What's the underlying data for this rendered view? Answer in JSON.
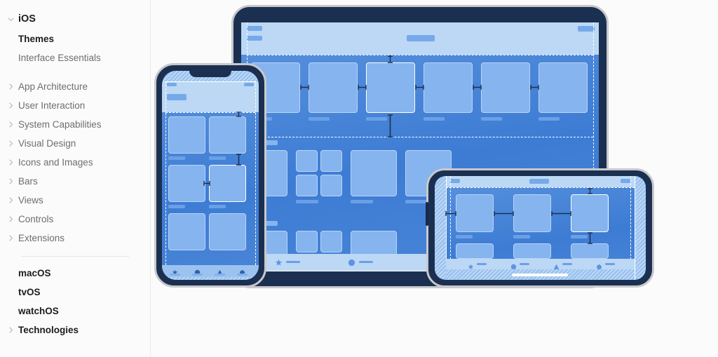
{
  "sidebar": {
    "root": {
      "label": "iOS",
      "icon": "chevron-down-icon",
      "expanded": true
    },
    "sub_items": [
      {
        "label": "Themes",
        "current": true
      },
      {
        "label": "Interface Essentials",
        "current": false
      }
    ],
    "groups": [
      {
        "label": "App Architecture",
        "icon": "chevron-right-icon"
      },
      {
        "label": "User Interaction",
        "icon": "chevron-right-icon"
      },
      {
        "label": "System Capabilities",
        "icon": "chevron-right-icon"
      },
      {
        "label": "Visual Design",
        "icon": "chevron-right-icon"
      },
      {
        "label": "Icons and Images",
        "icon": "chevron-right-icon"
      },
      {
        "label": "Bars",
        "icon": "chevron-right-icon"
      },
      {
        "label": "Views",
        "icon": "chevron-right-icon"
      },
      {
        "label": "Controls",
        "icon": "chevron-right-icon"
      },
      {
        "label": "Extensions",
        "icon": "chevron-right-icon"
      }
    ],
    "platforms": [
      {
        "label": "macOS",
        "icon": null
      },
      {
        "label": "tvOS",
        "icon": null
      },
      {
        "label": "watchOS",
        "icon": null
      },
      {
        "label": "Technologies",
        "icon": "chevron-right-icon"
      }
    ]
  },
  "illustration": {
    "description": "Adaptive layout diagram showing the same app content arranged on three device sizes with layout margin guides and spacing measurement marks.",
    "devices": [
      {
        "name": "tablet",
        "orientation": "landscape",
        "tab_icons": [
          "star-icon",
          "circle-icon"
        ]
      },
      {
        "name": "phone",
        "orientation": "portrait",
        "tab_icons": [
          "star-icon",
          "circle-icon",
          "triangle-icon",
          "pentagon-icon"
        ]
      },
      {
        "name": "phone-landscape",
        "orientation": "landscape",
        "tab_icons": [
          "star-icon",
          "circle-icon",
          "triangle-icon",
          "pentagon-icon"
        ]
      }
    ]
  },
  "colors": {
    "background": "#fbfbfb",
    "sidebar_text": "#6e6e73",
    "sidebar_text_active": "#1d1d1f",
    "device_bezel": "#1b3051",
    "device_edge": "#c9c9cd",
    "screen_blue": "#4a86d8",
    "card_blue": "#85b4ef",
    "header_blue": "#bcd8f5",
    "guide_white": "#ffffff",
    "measure_navy": "#1b3051"
  }
}
